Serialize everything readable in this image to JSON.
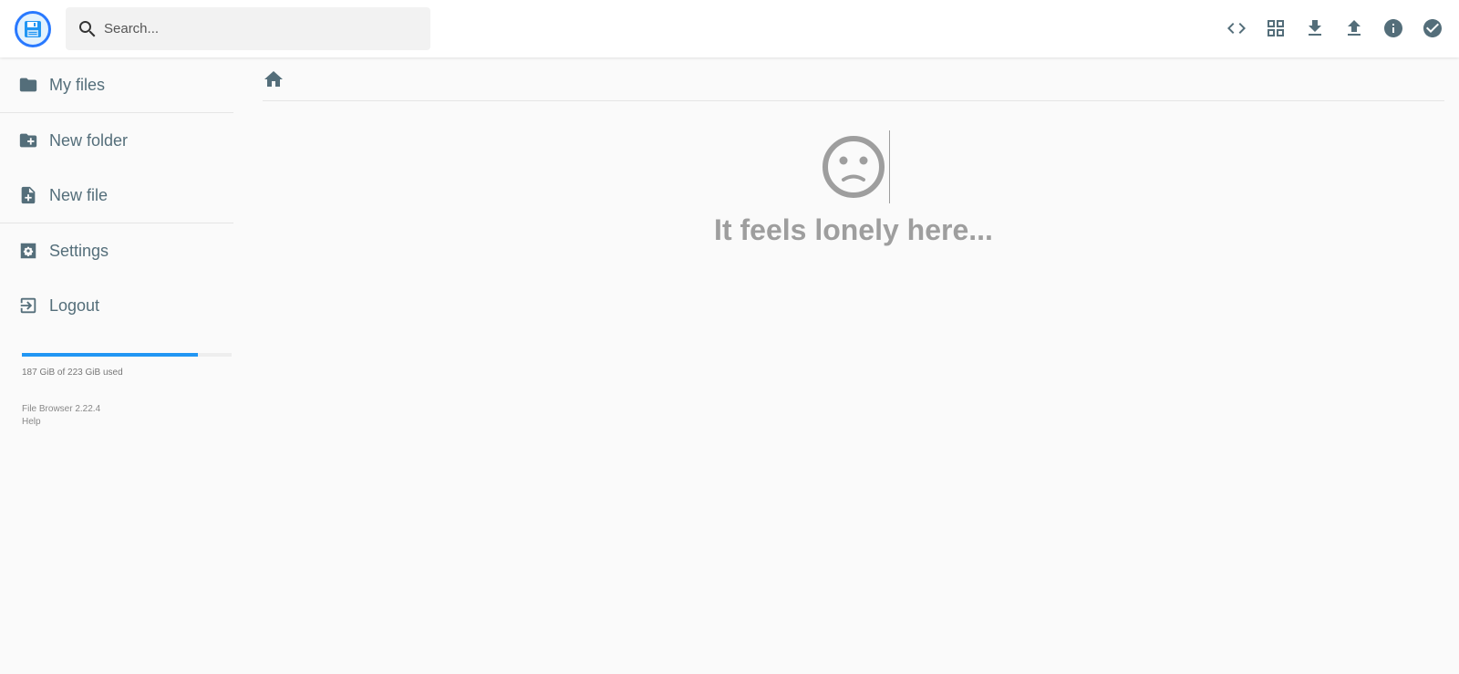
{
  "search": {
    "placeholder": "Search..."
  },
  "header": {
    "actions": [
      {
        "name": "code-icon",
        "label": "Code"
      },
      {
        "name": "grid-view-icon",
        "label": "Switch view"
      },
      {
        "name": "download-icon",
        "label": "Download"
      },
      {
        "name": "upload-icon",
        "label": "Upload"
      },
      {
        "name": "info-icon",
        "label": "Info"
      },
      {
        "name": "select-multiple-icon",
        "label": "Select multiple"
      }
    ]
  },
  "sidebar": {
    "items": [
      {
        "label": "My files",
        "icon": "folder-icon"
      },
      {
        "label": "New folder",
        "icon": "create-new-folder-icon"
      },
      {
        "label": "New file",
        "icon": "note-add-icon"
      },
      {
        "label": "Settings",
        "icon": "settings-icon"
      },
      {
        "label": "Logout",
        "icon": "logout-icon"
      }
    ],
    "quota": {
      "used_fraction": 0.8386,
      "text": "187 GiB of 223 GiB used"
    },
    "credits": {
      "version": "File Browser 2.22.4",
      "help": "Help"
    }
  },
  "main": {
    "empty_message": "It feels lonely here..."
  },
  "colors": {
    "accent": "#2196f3",
    "icon": "#546e7a",
    "empty_text": "#9e9e9e"
  }
}
